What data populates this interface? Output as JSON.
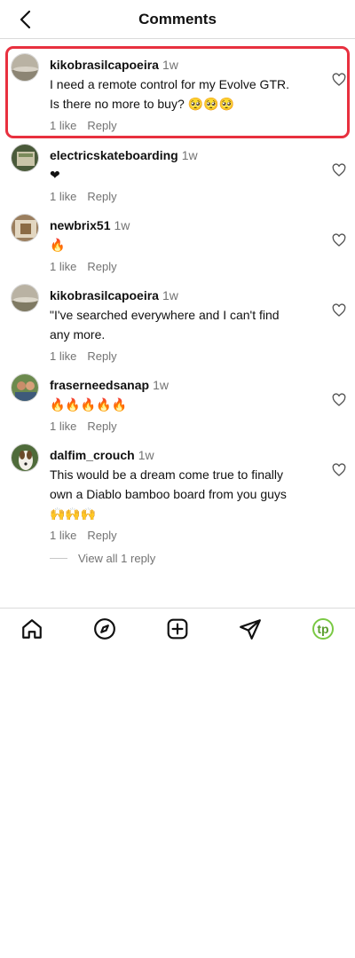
{
  "header": {
    "title": "Comments",
    "back_icon": "chevron-left-icon"
  },
  "comments": [
    {
      "username": "kikobrasilcapoeira",
      "time": "1w",
      "text": "I need a remote control for my Evolve GTR. Is there no more to buy? 🥺🥺🥺",
      "likes": "1 like",
      "reply_label": "Reply"
    },
    {
      "username": "electricskateboarding",
      "time": "1w",
      "text": "❤",
      "likes": "1 like",
      "reply_label": "Reply"
    },
    {
      "username": "newbrix51",
      "time": "1w",
      "text": "🔥",
      "likes": "1 like",
      "reply_label": "Reply"
    },
    {
      "username": "kikobrasilcapoeira",
      "time": "1w",
      "text": "\"I've searched everywhere and I can't find any more.",
      "likes": "1 like",
      "reply_label": "Reply"
    },
    {
      "username": "fraserneedsanap",
      "time": "1w",
      "text": "🔥🔥🔥🔥🔥",
      "likes": "1 like",
      "reply_label": "Reply"
    },
    {
      "username": "dalfim_crouch",
      "time": "1w",
      "text": "This would be a dream come true to finally own a Diablo bamboo board from you guys🙌🙌🙌",
      "likes": "1 like",
      "reply_label": "Reply"
    }
  ],
  "view_replies": "View all 1 reply",
  "nav": {
    "icons": [
      "home-icon",
      "explore-icon",
      "create-post-icon",
      "direct-message-icon",
      "profile-avatar-icon"
    ],
    "profile_initials": "tp"
  },
  "colors": {
    "highlight": "#e8303f",
    "secondary_text": "#737373",
    "profile_accent": "#7ac943"
  }
}
